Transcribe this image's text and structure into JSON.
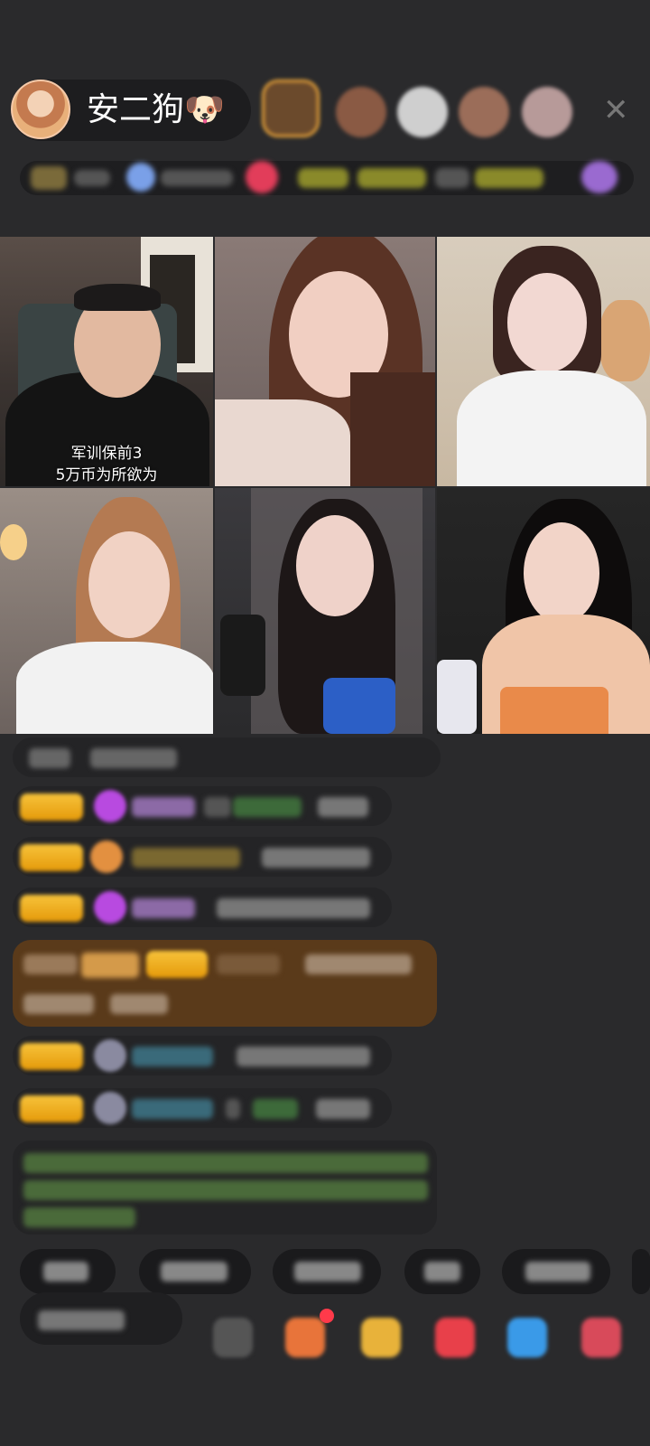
{
  "header": {
    "host_name": "安二狗",
    "host_emoji": "🐶",
    "close_icon": "✕"
  },
  "video_grid": {
    "tile1_caption_line1": "军训保前3",
    "tile1_caption_line2": "5万币为所欲为"
  },
  "icons": {
    "host_avatar": "avatar-icon",
    "close": "close-icon"
  }
}
